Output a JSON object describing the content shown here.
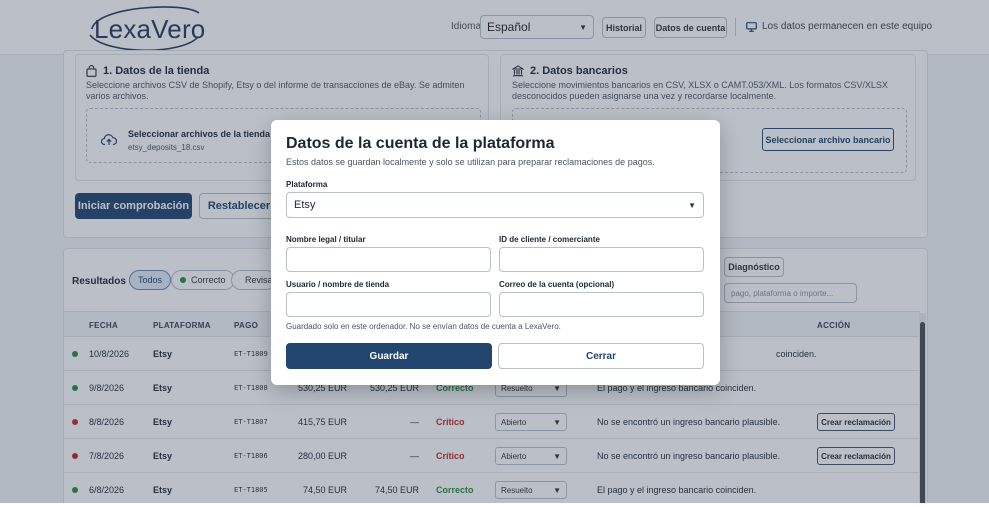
{
  "header": {
    "logo_text": "LexaVero",
    "language_label": "Idioma",
    "language_value": "Español",
    "history_button": "Historial",
    "account_button": "Datos de cuenta",
    "local_note": "Los datos permanecen en este equipo"
  },
  "store_card": {
    "title": "1. Datos de la tienda",
    "description": "Seleccione archivos CSV de Shopify, Etsy o del informe de transacciones de eBay. Se admiten varios archivos.",
    "file_button": "Seleccionar archivos de la tienda",
    "file_name": "etsy_deposits_18.csv"
  },
  "bank_card": {
    "title": "2. Datos bancarios",
    "description": "Seleccione movimientos bancarios en CSV, XLSX o CAMT.053/XML. Los formatos CSV/XLSX desconocidos pueden asignarse una vez y recordarse localmente.",
    "file_button": "Seleccionar archivo bancario"
  },
  "actions": {
    "start": "Iniciar comprobación",
    "reset": "Restablecer"
  },
  "results": {
    "label": "Resultados",
    "filters": [
      "Todos",
      "Correcto",
      "Revisa"
    ],
    "diagnostics_button": "Diagnóstico",
    "search_placeholder": "pago, plataforma o importe..."
  },
  "table": {
    "headers": [
      "FECHA",
      "PLATAFORMA",
      "PAGO",
      "ACCIÓN"
    ],
    "rows": [
      {
        "date": "10/8/2026",
        "platform": "Etsy",
        "payment": "ET-T1809",
        "amount": "",
        "bank": "",
        "status": "",
        "select": "",
        "note": "coinciden.",
        "action": ""
      },
      {
        "date": "9/8/2026",
        "platform": "Etsy",
        "payment": "ET-T1808",
        "amount": "530,25 EUR",
        "bank": "530,25 EUR",
        "status": "Correcto",
        "select": "Resuelto",
        "note": "El pago y el ingreso bancario coinciden.",
        "action": ""
      },
      {
        "date": "8/8/2026",
        "platform": "Etsy",
        "payment": "ET-T1807",
        "amount": "415,75 EUR",
        "bank": "—",
        "status": "Crítico",
        "select": "Abierto",
        "note": "No se encontró un ingreso bancario plausible.",
        "action": "Crear reclamación"
      },
      {
        "date": "7/8/2026",
        "platform": "Etsy",
        "payment": "ET-T1806",
        "amount": "280,00 EUR",
        "bank": "—",
        "status": "Crítico",
        "select": "Abierto",
        "note": "No se encontró un ingreso bancario plausible.",
        "action": "Crear reclamación"
      },
      {
        "date": "6/8/2026",
        "platform": "Etsy",
        "payment": "ET-T1805",
        "amount": "74,50 EUR",
        "bank": "74,50 EUR",
        "status": "Correcto",
        "select": "Resuelto",
        "note": "El pago y el ingreso bancario coinciden.",
        "action": ""
      }
    ]
  },
  "modal": {
    "title": "Datos de la cuenta de la plataforma",
    "subtitle": "Estos datos se guardan localmente y solo se utilizan para preparar reclamaciones de pagos.",
    "platform_label": "Plataforma",
    "platform_value": "Etsy",
    "legal_name_label": "Nombre legal / titular",
    "legal_name_value": "",
    "customer_id_label": "ID de cliente / comerciante",
    "customer_id_value": "",
    "username_label": "Usuario / nombre de tienda",
    "username_value": "",
    "email_label": "Correo de la cuenta (opcional)",
    "email_value": "",
    "note": "Guardado solo en este ordenador. No se envían datos de cuenta a LexaVero.",
    "save_button": "Guardar",
    "close_button": "Cerrar"
  },
  "colors": {
    "primary": "#22456f",
    "ok": "#2e8a3e",
    "critical": "#c62828",
    "warning": "#d9a21b",
    "overlay": "rgba(45,60,85,0.32)"
  }
}
